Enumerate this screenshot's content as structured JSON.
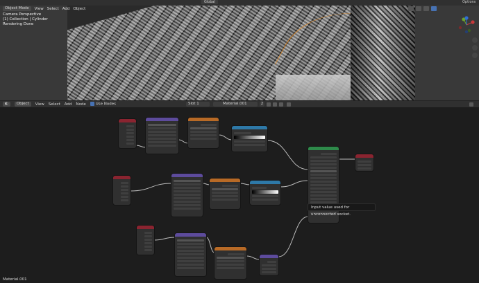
{
  "viewport": {
    "top_center_label": "Global",
    "options_label": "Options",
    "header": {
      "mode": "Object Mode",
      "menus": [
        "View",
        "Select",
        "Add",
        "Object"
      ]
    },
    "overlay": {
      "line1": "Camera Perspective",
      "line2": "(1) Collection | Cylinder",
      "line3": "Rendering Done"
    }
  },
  "node_editor": {
    "header": {
      "mode": "Object",
      "menus": [
        "View",
        "Select",
        "Add",
        "Node"
      ],
      "use_nodes_label": "Use Nodes",
      "slot": "Slot 1",
      "material": "Material.001",
      "users": "2"
    },
    "tooltip": "Input value used for unconnected socket.",
    "material_label": "Material.001"
  },
  "colors": {
    "accent": "#4772b3",
    "node_red": "#8a2430",
    "node_purple": "#5d4b9c",
    "node_orange": "#b86a26",
    "node_blue": "#2e79a8",
    "node_green": "#2e8a4a"
  }
}
